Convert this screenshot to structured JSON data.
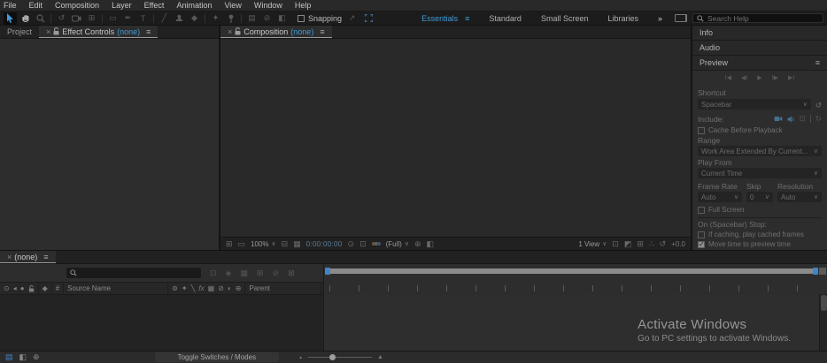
{
  "menu_bar": {
    "items": [
      "File",
      "Edit",
      "Composition",
      "Layer",
      "Effect",
      "Animation",
      "View",
      "Window",
      "Help"
    ]
  },
  "toolbar": {
    "snapping_label": "Snapping",
    "workspaces": [
      "Essentials",
      "Standard",
      "Small Screen",
      "Libraries"
    ],
    "active_workspace": "Essentials",
    "overflow": "»",
    "search": {
      "placeholder": "Search Help"
    }
  },
  "icons": {
    "hamburger": "≡",
    "close": "×",
    "chevron_down": "∨",
    "rotation": "↺",
    "pan_behind": "⊞",
    "rectangle": "▭",
    "pen": "✒",
    "type": "T",
    "brush": "╱",
    "eraser": "◆",
    "roto_brush": "✦",
    "mask_a": "▤",
    "mask_b": "⊘",
    "mask_c": "◧",
    "snap_diag": "↗",
    "reset": "↺",
    "loop": "↻",
    "overlay": "⊡",
    "vt_window": "⊞",
    "vt_monitor": "▭",
    "vt_roi": "⊟",
    "vt_grid": "▦",
    "vt_snapshot": "⊙",
    "vt_show_snapshot": "⊡",
    "vt_target": "⊕",
    "vt_mask": "◧",
    "vt_pixel_aspect": "⊡",
    "vt_fast_preview": "◩",
    "vt_mini_flow": "⊞",
    "vt_flow_tree": "∴",
    "tl_comp_flow": "⊡",
    "tl_draft3d": "◈",
    "tl_shy": "▦",
    "tl_frame_blend": "⊞",
    "tl_motion_blur": "⊘",
    "tl_graph": "⊠",
    "col_eye": "⊙",
    "col_audio": "◂",
    "col_solo": "●",
    "col_tag": "◆",
    "col_hash": "#",
    "sw_shy": "⊚",
    "sw_collapse": "✦",
    "sw_quality": "╲",
    "sw_fx": "fx",
    "sw_frame_blend": "▦",
    "sw_motion_blur": "⊘",
    "sw_adjustment": "◐",
    "sw_3d": "⊕",
    "pane_switches": "▤",
    "pane_transfer": "◧",
    "pane_inout": "⊕",
    "mountain": "▲"
  },
  "panels": {
    "left": {
      "tabs": [
        {
          "label": "Project"
        },
        {
          "label": "Effect Controls",
          "value": "(none)"
        }
      ]
    },
    "composition": {
      "tab": {
        "label": "Composition",
        "value": "(none)"
      },
      "toolbar": {
        "zoom": "100%",
        "timecode": "0:00:00:00",
        "resolution": "(Full)",
        "view": "1 View",
        "exposure": "+0.0"
      }
    },
    "sidebar": {
      "sections": {
        "info": "Info",
        "audio": "Audio",
        "preview": "Preview"
      },
      "preview": {
        "transport": [
          "I◀",
          "◀I",
          "▶",
          "I▶",
          "▶I"
        ],
        "shortcut_label": "Shortcut",
        "shortcut_value": "Spacebar",
        "include_label": "Include:",
        "cache_label": "Cache Before Playback",
        "range_label": "Range",
        "range_value": "Work Area Extended By Current...",
        "play_from_label": "Play From",
        "play_from_value": "Current Time",
        "frame_rate_label": "Frame Rate",
        "frame_rate_value": "Auto",
        "skip_label": "Skip",
        "skip_value": "0",
        "resolution_label": "Resolution",
        "resolution_value": "Auto",
        "full_screen_label": "Full Screen",
        "on_stop_label": "On (Spacebar) Stop:",
        "if_caching_label": "If caching, play cached frames",
        "move_time_label": "Move time to preview time"
      }
    },
    "timeline": {
      "tab": {
        "label": "(none)"
      },
      "columns": {
        "source_name": "Source Name",
        "parent": "Parent"
      },
      "toggle_button": "Toggle Switches / Modes"
    }
  },
  "watermark": {
    "title": "Activate Windows",
    "subtitle": "Go to PC settings to activate Windows."
  }
}
